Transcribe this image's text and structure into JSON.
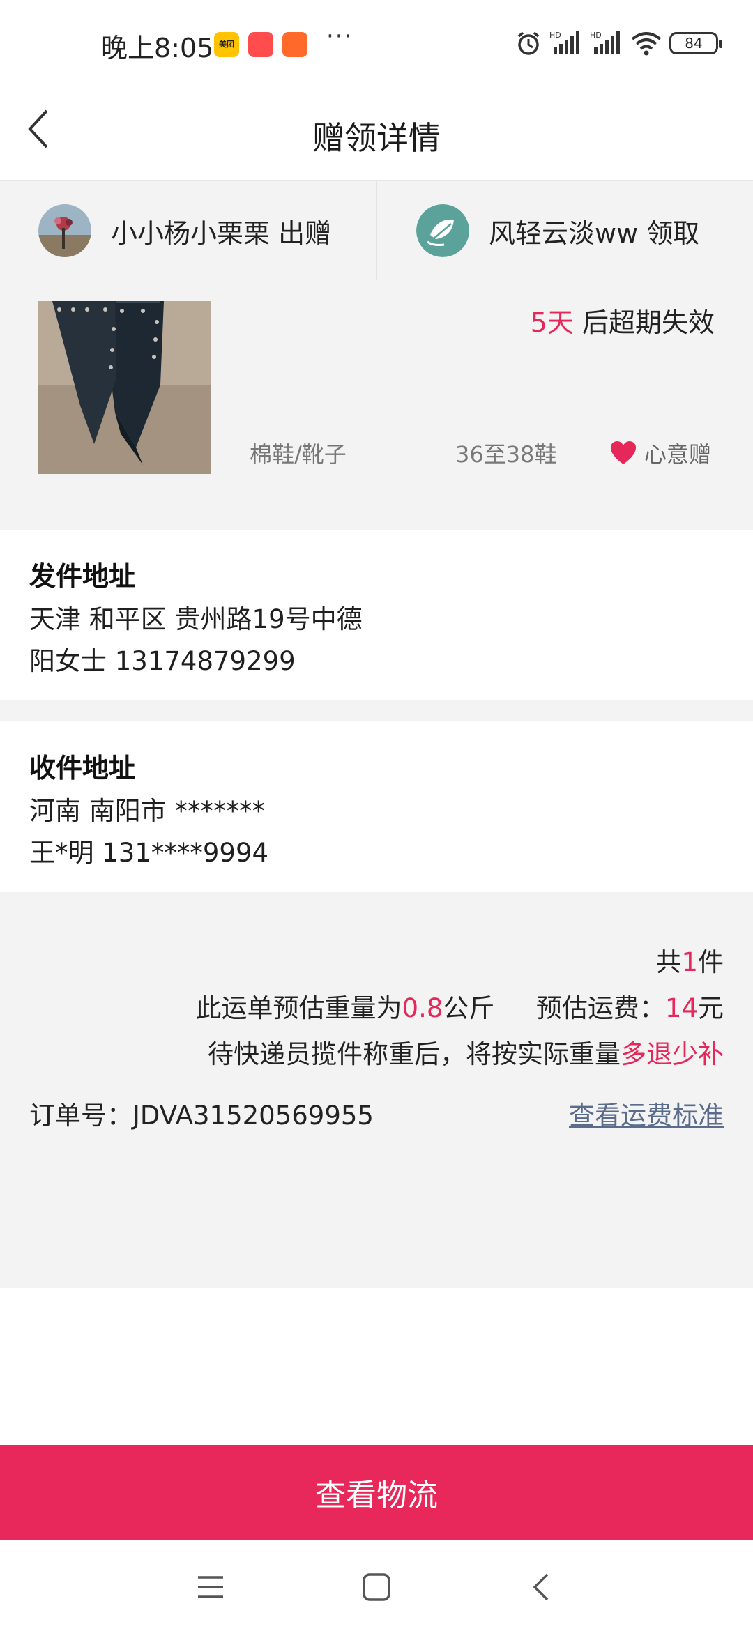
{
  "status_bar": {
    "time": "晚上8:05",
    "apps": [
      {
        "name": "meituan",
        "label": "美团",
        "color": "#ffc300"
      },
      {
        "name": "app2",
        "label": "",
        "color": "#ff4d4d"
      },
      {
        "name": "app3",
        "label": "",
        "color": "#ff5a2a"
      }
    ],
    "more": "···",
    "battery": "84"
  },
  "header": {
    "title": "赠领详情",
    "back_icon": "chevron-left-icon"
  },
  "parties": {
    "giver": {
      "name": "小小杨小栗栗 出赠"
    },
    "receiver": {
      "name": "风轻云淡ww 领取"
    }
  },
  "item": {
    "expire_days": "5天",
    "expire_suffix": " 后超期失效",
    "category": "棉鞋/靴子",
    "size": "36至38鞋",
    "tag": "心意赠"
  },
  "sender": {
    "title": "发件地址",
    "address": "天津 和平区 贵州路19号中德",
    "contact": "阳女士 13174879299"
  },
  "receiver": {
    "title": "收件地址",
    "address": "河南 南阳市 *******",
    "contact": "王*明 131****9994"
  },
  "summary": {
    "count_prefix": "共",
    "count": "1",
    "count_suffix": "件",
    "weight_prefix": "此运单预估重量为",
    "weight": "0.8",
    "weight_unit": "公斤",
    "fee_prefix": "预估运费：",
    "fee": "14",
    "fee_unit": "元",
    "note_prefix": "待快递员揽件称重后，将按实际重量",
    "note_accent": "多退少补",
    "order_label": "订单号：JDVA31520569955",
    "fee_link": "查看运费标准"
  },
  "actions": {
    "logistics": "查看物流"
  },
  "colors": {
    "accent": "#e6275a",
    "button": "#e8285a",
    "link": "#5a6b8c"
  }
}
